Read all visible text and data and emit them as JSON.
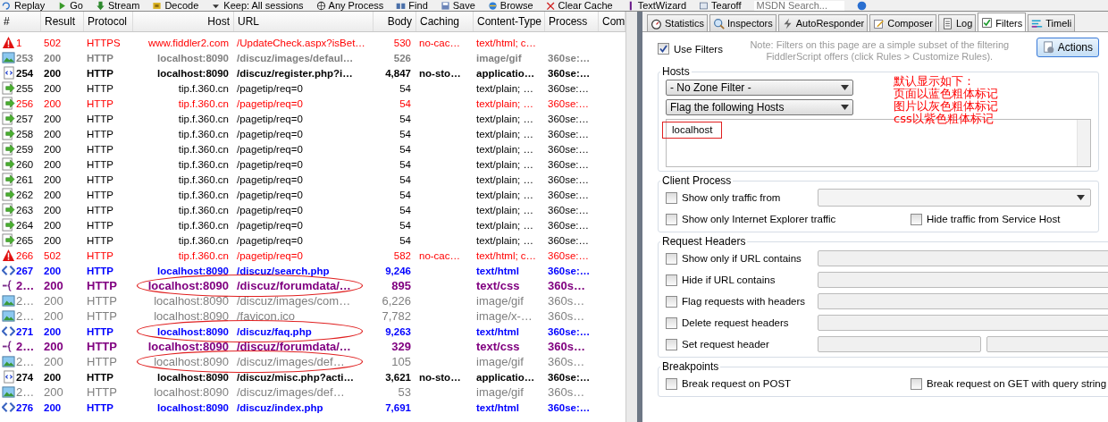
{
  "toolbar": [
    {
      "label": "Replay",
      "kind": "replay"
    },
    {
      "label": "Go",
      "kind": "go"
    },
    {
      "label": "Stream",
      "kind": "stream"
    },
    {
      "label": "Decode",
      "kind": "decode"
    },
    {
      "label": "Keep: All sessions",
      "kind": "keep"
    },
    {
      "label": "Any Process",
      "kind": "process"
    },
    {
      "label": "Find",
      "kind": "find"
    },
    {
      "label": "Save",
      "kind": "save"
    },
    {
      "label": "Browse",
      "kind": "browse"
    },
    {
      "label": "Clear Cache",
      "kind": "clear"
    },
    {
      "label": "TextWizard",
      "kind": "wizard"
    },
    {
      "label": "Tearoff",
      "kind": "tearoff"
    }
  ],
  "toolbar_search": {
    "placeholder": "MSDN Search..."
  },
  "sessions": {
    "columns": [
      "#",
      "Result",
      "Protocol",
      "Host",
      "URL",
      "Body",
      "Caching",
      "Content-Type",
      "Process",
      "Com"
    ],
    "rows": [
      {
        "kind": "warning",
        "circled": false,
        "id": "1",
        "result": "502",
        "protocol": "HTTPS",
        "host": "www.fiddler2.com",
        "url": "/UpdateCheck.aspx?isBet…",
        "body": "530",
        "caching": "no-cac…",
        "content_type": "text/html; c…"
      },
      {
        "kind": "image-bold",
        "circled": false,
        "id": "253",
        "result": "200",
        "protocol": "HTTP",
        "host": "localhost:8090",
        "url": "/discuz/images/defaul…",
        "body": "526",
        "content_type": "image/gif",
        "process": "360se:…"
      },
      {
        "kind": "script",
        "circled": false,
        "id": "254",
        "result": "200",
        "protocol": "HTTP",
        "host": "localhost:8090",
        "url": "/discuz/register.php?i…",
        "body": "4,847",
        "caching": "no-sto…",
        "content_type": "applicatio…",
        "process": "360se:…"
      },
      {
        "kind": "arrow",
        "circled": false,
        "id": "255",
        "result": "200",
        "protocol": "HTTP",
        "host": "tip.f.360.cn",
        "url": "/pagetip/req=0",
        "body": "54",
        "content_type": "text/plain; …",
        "process": "360se:…"
      },
      {
        "kind": "arrow-alert",
        "circled": false,
        "id": "256",
        "result": "200",
        "protocol": "HTTP",
        "host": "tip.f.360.cn",
        "url": "/pagetip/req=0",
        "body": "54",
        "content_type": "text/plain; …",
        "process": "360se:…"
      },
      {
        "kind": "arrow",
        "circled": false,
        "id": "257",
        "result": "200",
        "protocol": "HTTP",
        "host": "tip.f.360.cn",
        "url": "/pagetip/req=0",
        "body": "54",
        "content_type": "text/plain; …",
        "process": "360se:…"
      },
      {
        "kind": "arrow",
        "circled": false,
        "id": "258",
        "result": "200",
        "protocol": "HTTP",
        "host": "tip.f.360.cn",
        "url": "/pagetip/req=0",
        "body": "54",
        "content_type": "text/plain; …",
        "process": "360se:…"
      },
      {
        "kind": "arrow",
        "circled": false,
        "id": "259",
        "result": "200",
        "protocol": "HTTP",
        "host": "tip.f.360.cn",
        "url": "/pagetip/req=0",
        "body": "54",
        "content_type": "text/plain; …",
        "process": "360se:…"
      },
      {
        "kind": "arrow",
        "circled": false,
        "id": "260",
        "result": "200",
        "protocol": "HTTP",
        "host": "tip.f.360.cn",
        "url": "/pagetip/req=0",
        "body": "54",
        "content_type": "text/plain; …",
        "process": "360se:…"
      },
      {
        "kind": "arrow",
        "circled": false,
        "id": "261",
        "result": "200",
        "protocol": "HTTP",
        "host": "tip.f.360.cn",
        "url": "/pagetip/req=0",
        "body": "54",
        "content_type": "text/plain; …",
        "process": "360se:…"
      },
      {
        "kind": "arrow",
        "circled": false,
        "id": "262",
        "result": "200",
        "protocol": "HTTP",
        "host": "tip.f.360.cn",
        "url": "/pagetip/req=0",
        "body": "54",
        "content_type": "text/plain; …",
        "process": "360se:…"
      },
      {
        "kind": "arrow",
        "circled": false,
        "id": "263",
        "result": "200",
        "protocol": "HTTP",
        "host": "tip.f.360.cn",
        "url": "/pagetip/req=0",
        "body": "54",
        "content_type": "text/plain; …",
        "process": "360se:…"
      },
      {
        "kind": "arrow",
        "circled": false,
        "id": "264",
        "result": "200",
        "protocol": "HTTP",
        "host": "tip.f.360.cn",
        "url": "/pagetip/req=0",
        "body": "54",
        "content_type": "text/plain; …",
        "process": "360se:…"
      },
      {
        "kind": "arrow",
        "circled": false,
        "id": "265",
        "result": "200",
        "protocol": "HTTP",
        "host": "tip.f.360.cn",
        "url": "/pagetip/req=0",
        "body": "54",
        "content_type": "text/plain; …",
        "process": "360se:…"
      },
      {
        "kind": "warning",
        "circled": false,
        "id": "266",
        "result": "502",
        "protocol": "HTTP",
        "host": "tip.f.360.cn",
        "url": "/pagetip/req=0",
        "body": "582",
        "caching": "no-cac…",
        "content_type": "text/html; c…",
        "process": "360se:…"
      },
      {
        "kind": "html",
        "circled": false,
        "id": "267",
        "result": "200",
        "protocol": "HTTP",
        "host": "localhost:8090",
        "url": "/discuz/search.php",
        "body": "9,246",
        "content_type": "text/html",
        "process": "360se:…"
      },
      {
        "kind": "css",
        "circled": true,
        "id": "2…",
        "result": "200",
        "protocol": "HTTP",
        "host": "localhost:8090",
        "url": "/discuz/forumdata/…",
        "body": "895",
        "content_type": "text/css",
        "process": "360s…"
      },
      {
        "kind": "image",
        "circled": false,
        "id": "2…",
        "result": "200",
        "protocol": "HTTP",
        "host": "localhost:8090",
        "url": "/discuz/images/com…",
        "body": "6,226",
        "content_type": "image/gif",
        "process": "360s…"
      },
      {
        "kind": "image",
        "circled": false,
        "id": "2…",
        "result": "200",
        "protocol": "HTTP",
        "host": "localhost:8090",
        "url": "/favicon.ico",
        "body": "7,782",
        "content_type": "image/x-…",
        "process": "360s…"
      },
      {
        "kind": "html",
        "circled": true,
        "id": "271",
        "result": "200",
        "protocol": "HTTP",
        "host": "localhost:8090",
        "url": "/discuz/faq.php",
        "body": "9,263",
        "content_type": "text/html",
        "process": "360se:…"
      },
      {
        "kind": "css",
        "circled": false,
        "id": "2…",
        "result": "200",
        "protocol": "HTTP",
        "host": "localhost:8090",
        "url": "/discuz/forumdata/…",
        "body": "329",
        "content_type": "text/css",
        "process": "360s…"
      },
      {
        "kind": "image",
        "circled": true,
        "id": "2…",
        "result": "200",
        "protocol": "HTTP",
        "host": "localhost:8090",
        "url": "/discuz/images/def…",
        "body": "105",
        "content_type": "image/gif",
        "process": "360s…"
      },
      {
        "kind": "script",
        "circled": false,
        "id": "274",
        "result": "200",
        "protocol": "HTTP",
        "host": "localhost:8090",
        "url": "/discuz/misc.php?acti…",
        "body": "3,621",
        "caching": "no-sto…",
        "content_type": "applicatio…",
        "process": "360se:…"
      },
      {
        "kind": "image",
        "circled": false,
        "id": "2…",
        "result": "200",
        "protocol": "HTTP",
        "host": "localhost:8090",
        "url": "/discuz/images/def…",
        "body": "53",
        "content_type": "image/gif",
        "process": "360s…"
      },
      {
        "kind": "html",
        "circled": false,
        "id": "276",
        "result": "200",
        "protocol": "HTTP",
        "host": "localhost:8090",
        "url": "/discuz/index.php",
        "body": "7,691",
        "content_type": "text/html",
        "process": "360se:…"
      }
    ]
  },
  "inspector_tabs": [
    {
      "label": "Statistics",
      "kind": "stopwatch",
      "selected": false
    },
    {
      "label": "Inspectors",
      "kind": "magnifier",
      "selected": false
    },
    {
      "label": "AutoResponder",
      "kind": "bolt",
      "selected": false
    },
    {
      "label": "Composer",
      "kind": "pencil",
      "selected": false
    },
    {
      "label": "Log",
      "kind": "log",
      "selected": false
    },
    {
      "label": "Filters",
      "kind": "check",
      "selected": true
    },
    {
      "label": "Timeli",
      "kind": "timeline",
      "selected": false
    }
  ],
  "filters": {
    "use_filters": {
      "label": "Use Filters",
      "checked": true
    },
    "note": "Note: Filters on this page are a simple subset of the filtering FiddlerScript offers (click Rules > Customize Rules).",
    "actions_button": "Actions",
    "hosts": {
      "title": "Hosts",
      "zone_filter": "- No Zone Filter -",
      "host_filter": "Flag the following Hosts",
      "host_list": {
        "text": "localhost",
        "highlighted": true
      }
    },
    "groups": [
      {
        "title": "Client Process",
        "rows": [
          [
            {
              "label": "Show only traffic from",
              "checked": false,
              "kind": "dropdown"
            }
          ],
          [
            {
              "label": "Show only Internet Explorer traffic",
              "checked": false,
              "kind": "plain"
            },
            {
              "label": "Hide traffic from Service Host",
              "checked": false,
              "kind": "plain"
            }
          ]
        ]
      },
      {
        "title": "Request Headers",
        "rows": [
          [
            {
              "label": "Show only if URL contains",
              "checked": false,
              "kind": "field"
            }
          ],
          [
            {
              "label": "Hide if URL contains",
              "checked": false,
              "kind": "field"
            }
          ],
          [
            {
              "label": "Flag requests with headers",
              "checked": false,
              "kind": "field"
            }
          ],
          [
            {
              "label": "Delete request headers",
              "checked": false,
              "kind": "field"
            }
          ],
          [
            {
              "label": "Set request header",
              "checked": false,
              "kind": "two_fields"
            }
          ]
        ]
      },
      {
        "title": "Breakpoints",
        "rows": [
          [
            {
              "label": "Break request on POST",
              "checked": false,
              "kind": "plain"
            },
            {
              "label": "Break request on GET with query string",
              "checked": false,
              "kind": "plain"
            }
          ]
        ]
      }
    ]
  },
  "annotation_lines": [
    "默认显示如下：",
    "页面以蓝色粗体标记",
    "图片以灰色粗体标记",
    "css以紫色粗体标记"
  ]
}
